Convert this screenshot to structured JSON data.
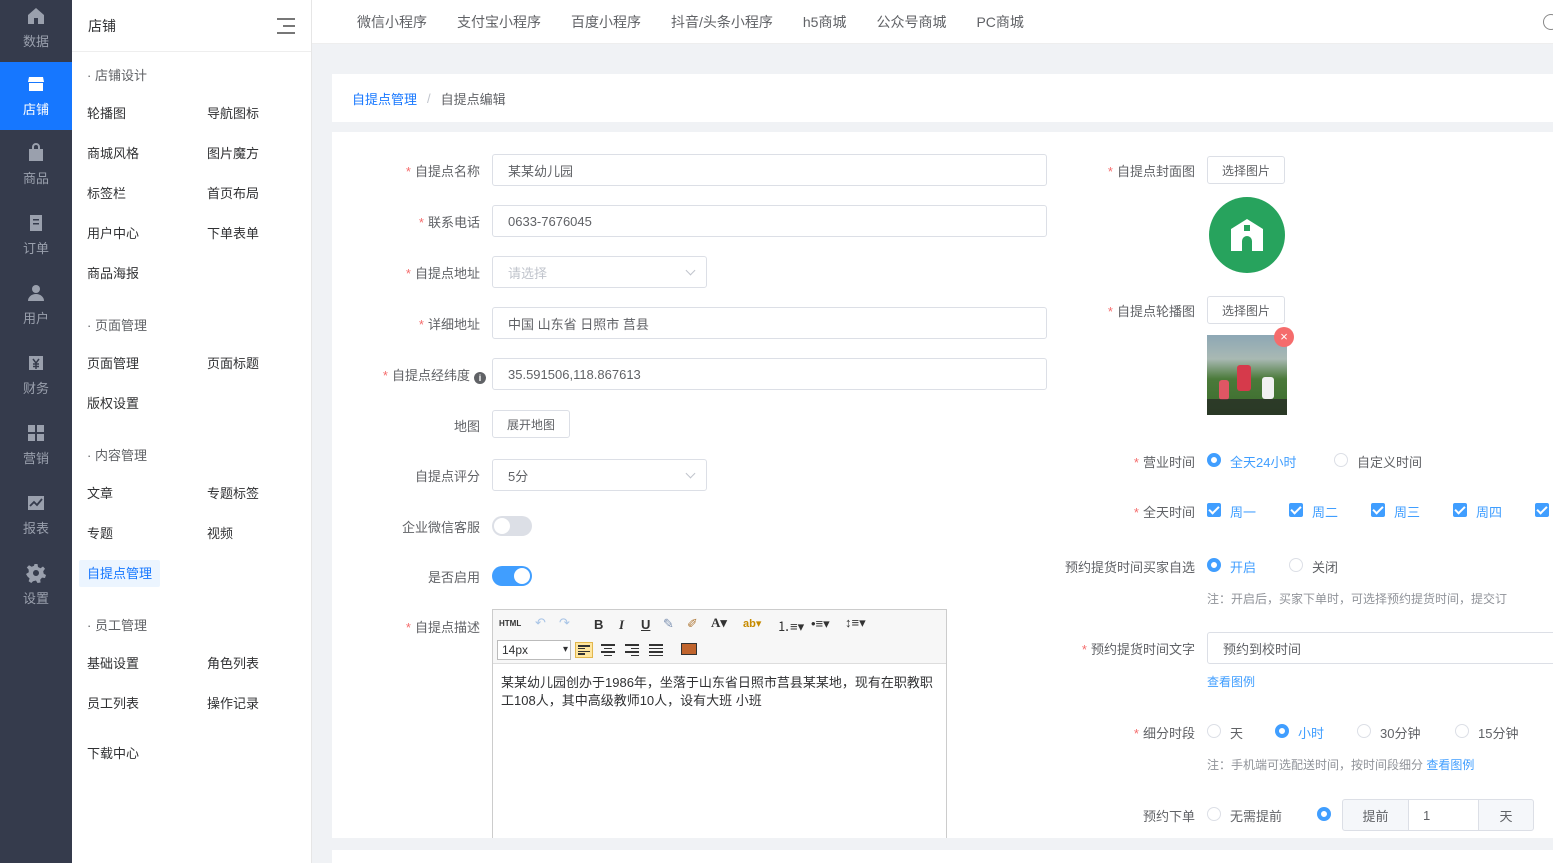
{
  "rail": [
    {
      "label": "数据",
      "icon": "home-icon"
    },
    {
      "label": "店铺",
      "icon": "store-icon"
    },
    {
      "label": "商品",
      "icon": "bag-icon"
    },
    {
      "label": "订单",
      "icon": "order-icon"
    },
    {
      "label": "用户",
      "icon": "user-icon"
    },
    {
      "label": "财务",
      "icon": "finance-icon"
    },
    {
      "label": "营销",
      "icon": "marketing-icon"
    },
    {
      "label": "报表",
      "icon": "report-icon"
    },
    {
      "label": "设置",
      "icon": "gear-icon"
    }
  ],
  "submenu": {
    "title": "店铺",
    "groups": [
      {
        "title": "· 店铺设计",
        "items": [
          "轮播图",
          "导航图标",
          "商城风格",
          "图片魔方",
          "标签栏",
          "首页布局",
          "用户中心",
          "下单表单",
          "商品海报"
        ]
      },
      {
        "title": "· 页面管理",
        "items": [
          "页面管理",
          "页面标题",
          "版权设置"
        ]
      },
      {
        "title": "· 内容管理",
        "items": [
          "文章",
          "专题标签",
          "专题",
          "视频",
          "自提点管理"
        ]
      },
      {
        "title": "· 员工管理",
        "items": [
          "基础设置",
          "角色列表",
          "员工列表",
          "操作记录"
        ]
      }
    ],
    "download": "下载中心"
  },
  "topnav": [
    "微信小程序",
    "支付宝小程序",
    "百度小程序",
    "抖音/头条小程序",
    "h5商城",
    "公众号商城",
    "PC商城"
  ],
  "breadcrumb": {
    "parent": "自提点管理",
    "sep": "/",
    "current": "自提点编辑"
  },
  "form": {
    "name": {
      "label": "自提点名称",
      "value": "某某幼儿园"
    },
    "phone": {
      "label": "联系电话",
      "value": "0633-7676045"
    },
    "address": {
      "label": "自提点地址",
      "placeholder": "请选择"
    },
    "detail": {
      "label": "详细地址",
      "value": "中国 山东省 日照市 莒县"
    },
    "latlng": {
      "label": "自提点经纬度",
      "value": "35.591506,118.867613"
    },
    "map": {
      "label": "地图",
      "button": "展开地图"
    },
    "rating": {
      "label": "自提点评分",
      "value": "5分"
    },
    "wechat": {
      "label": "企业微信客服"
    },
    "enabled": {
      "label": "是否启用"
    },
    "desc": {
      "label": "自提点描述",
      "fontsize": "14px",
      "html_btn": "HTML",
      "text": "某某幼儿园创办于1986年，坐落于山东省日照市莒县某某地，现有在职教职工108人，其中高级教师10人，设有大班 小班"
    },
    "cover": {
      "label": "自提点封面图",
      "button": "选择图片"
    },
    "carousel": {
      "label": "自提点轮播图",
      "button": "选择图片"
    },
    "hours": {
      "label": "营业时间",
      "opt1": "全天24小时",
      "opt2": "自定义时间"
    },
    "days": {
      "label": "全天时间",
      "items": [
        "周一",
        "周二",
        "周三",
        "周四"
      ]
    },
    "selfpick": {
      "label": "预约提货时间买家自选",
      "opt1": "开启",
      "opt2": "关闭",
      "note": "注：开启后，买家下单时，可选择预约提货时间，提交订"
    },
    "picktext": {
      "label": "预约提货时间文字",
      "value": "预约到校时间",
      "link": "查看图例"
    },
    "slot": {
      "label": "细分时段",
      "opts": [
        "天",
        "小时",
        "30分钟",
        "15分钟"
      ],
      "note": "注：手机端可选配送时间，按时间段细分",
      "link": "查看图例"
    },
    "order": {
      "label": "预约下单",
      "opt1": "无需提前",
      "prefix": "提前",
      "value": "1",
      "suffix": "天"
    }
  }
}
